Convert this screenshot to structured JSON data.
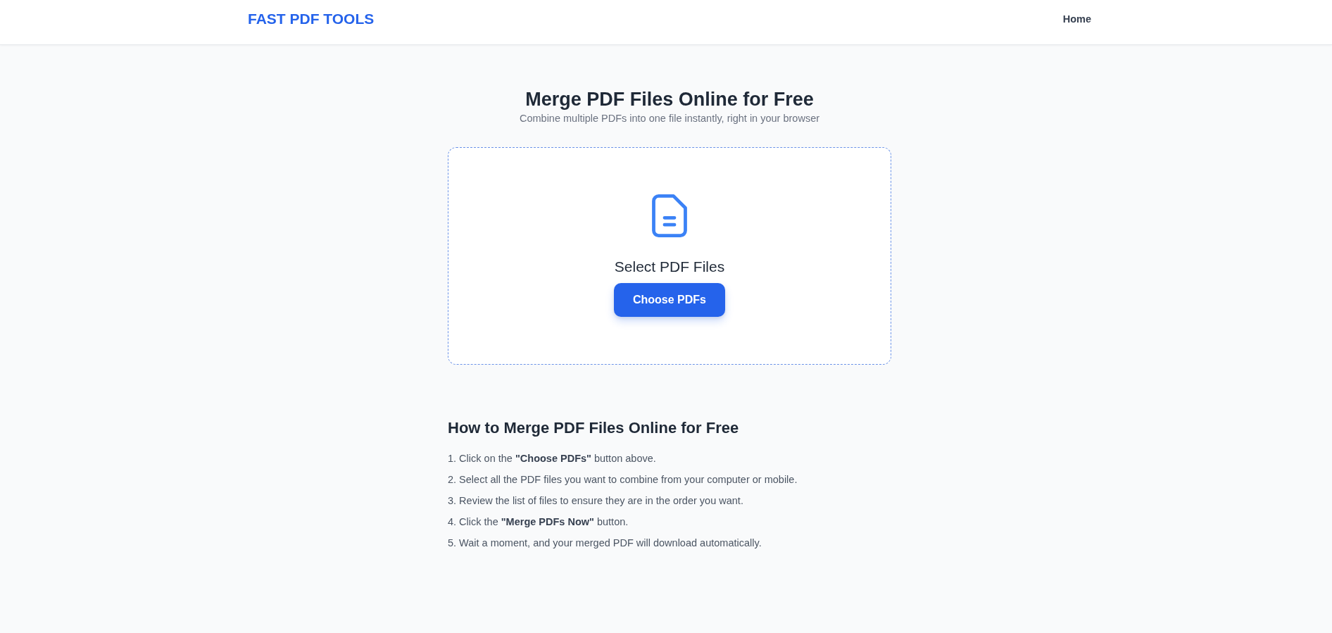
{
  "header": {
    "logo": "FAST PDF TOOLS",
    "nav": [
      {
        "label": "Home"
      }
    ]
  },
  "hero": {
    "title": "Merge PDF Files Online for Free",
    "subtitle": "Combine multiple PDFs into one file instantly, right in your browser"
  },
  "upload": {
    "label": "Select PDF Files",
    "button": "Choose PDFs"
  },
  "howto": {
    "heading": "How to Merge PDF Files Online for Free",
    "steps": [
      "1. Click on the **\"Choose PDFs\"** button above.",
      "2. Select all the PDF files you want to combine from your computer or mobile.",
      "3. Review the list of files to ensure they are in the order you want.",
      "4. Click the **\"Merge PDFs Now\"** button.",
      "5. Wait a moment, and your merged PDF will download automatically."
    ]
  }
}
